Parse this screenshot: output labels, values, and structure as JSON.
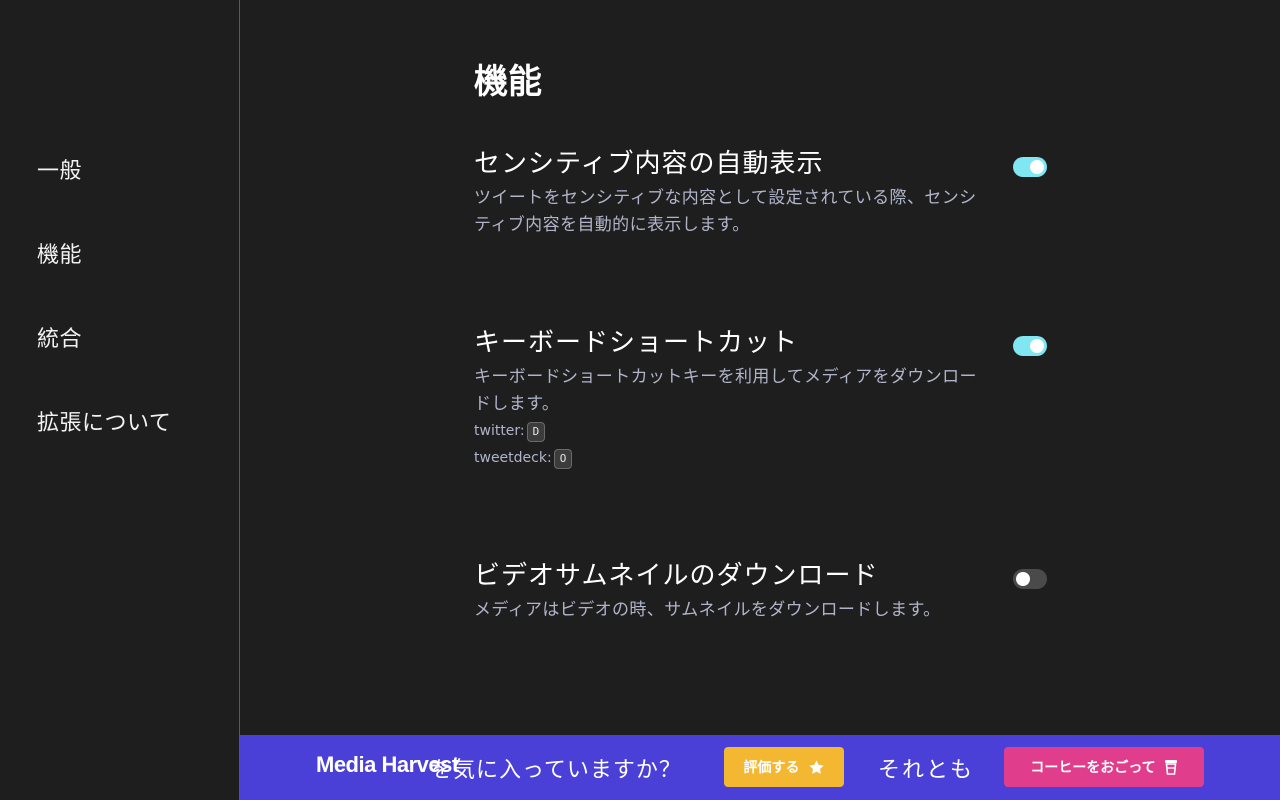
{
  "sidebar": {
    "items": [
      {
        "label": "一般"
      },
      {
        "label": "機能"
      },
      {
        "label": "統合"
      },
      {
        "label": "拡張について"
      }
    ]
  },
  "main": {
    "title": "機能",
    "settings": [
      {
        "title": "センシティブ内容の自動表示",
        "description": "ツイートをセンシティブな内容として設定されている際、センシティブ内容を自動的に表示します。",
        "enabled": true
      },
      {
        "title": "キーボードショートカット",
        "description": "キーボードショートカットキーを利用してメディアをダウンロードします。",
        "enabled": true,
        "shortcuts": [
          {
            "label": "twitter:",
            "key": "D"
          },
          {
            "label": "tweetdeck:",
            "key": "O"
          }
        ]
      },
      {
        "title": "ビデオサムネイルのダウンロード",
        "description": "メディアはビデオの時、サムネイルをダウンロードします。",
        "enabled": false
      }
    ]
  },
  "footer": {
    "brand": "Media Harvest",
    "question": "を気に入っていますか？",
    "rate_label": "評価する",
    "or_label": "それとも",
    "coffee_label": "コーヒーをおごって"
  },
  "colors": {
    "background": "#1e1e1e",
    "toggle_on": "#7fe6f2",
    "toggle_off": "#4a4a4a",
    "footer_bg": "#4a3fd6",
    "rate_button": "#f4b731",
    "coffee_button": "#e03e8c",
    "description_text": "#b0b4c9"
  },
  "icons": {
    "rate": "star-icon",
    "coffee": "coffee-cup-icon"
  }
}
